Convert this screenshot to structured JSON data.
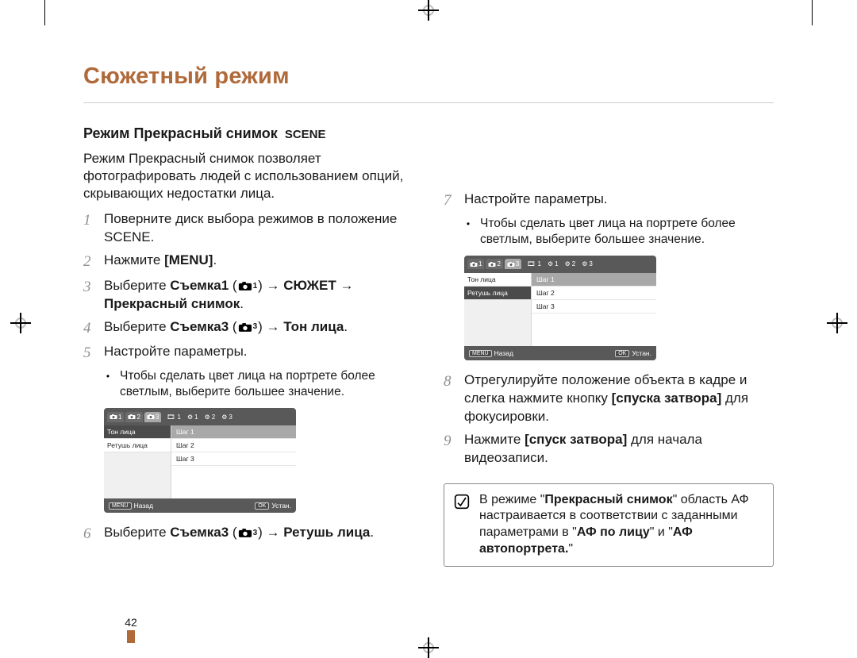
{
  "page": {
    "page_number": "42",
    "chapter_title": "Сюжетный режим",
    "section_title": "Режим Прекрасный снимок",
    "scene_word": "SCENE",
    "intro": "Режим Прекрасный снимок позволяет фотографировать людей с использованием опций, скрывающих недостатки лица."
  },
  "col_left": {
    "steps": {
      "s1_a": "Поверните диск выбора режимов в положение ",
      "s1_b": ".",
      "s2_a": "Нажмите ",
      "s2_menu": "[MENU]",
      "s2_b": ".",
      "s3_a": "Выберите ",
      "s3_bold1": "Съемка1",
      "s3_mid1": " (",
      "s3_mid2": ") → ",
      "s3_bold2": "СЮЖЕТ",
      "s3_mid3": " → ",
      "s3_bold3": "Прекрасный снимок",
      "s3_end": ".",
      "s4_a": "Выберите ",
      "s4_bold1": "Съемка3",
      "s4_mid1": " (",
      "s4_mid2": ") → ",
      "s4_bold2": "Тон лица",
      "s4_end": ".",
      "s5": "Настройте параметры.",
      "s5_sub": "Чтобы сделать цвет лица на портрете более светлым, выберите большее значение.",
      "s6_a": "Выберите ",
      "s6_bold1": "Съемка3",
      "s6_mid1": " (",
      "s6_mid2": ") → ",
      "s6_bold2": "Ретушь лица",
      "s6_end": "."
    }
  },
  "col_right": {
    "steps": {
      "s7": "Настройте параметры.",
      "s7_sub": "Чтобы сделать цвет лица на портрете более светлым, выберите большее значение.",
      "s8_a": "Отрегулируйте положение объекта в кадре и слегка нажмите кнопку ",
      "s8_bold": "[спуска затвора]",
      "s8_b": " для фокусировки.",
      "s9_a": "Нажмите ",
      "s9_bold": "[спуск затвора]",
      "s9_b": " для начала видеозаписи."
    },
    "note_a": "В режиме \"",
    "note_bold1": "Прекрасный снимок",
    "note_b": "\" область АФ настраивается в соответствии с заданными параметрами в \"",
    "note_bold2": "АФ по лицу",
    "note_c": "\" и \"",
    "note_bold3": "АФ автопортрета.",
    "note_d": "\""
  },
  "screenshot_a": {
    "left_rows": [
      "Тон лица",
      "Ретушь лица"
    ],
    "left_selected": 0,
    "right_rows": [
      "Шаг 1",
      "Шаг 2",
      "Шаг 3"
    ],
    "right_hl": 0,
    "footer": {
      "left_btn": "MENU",
      "left_txt": "Назад",
      "right_btn": "OK",
      "right_txt": "Устан."
    }
  },
  "screenshot_b": {
    "left_rows": [
      "Тон лица",
      "Ретушь лица"
    ],
    "left_selected": 1,
    "right_rows": [
      "Шаг 1",
      "Шаг 2",
      "Шаг 3"
    ],
    "right_hl": 0,
    "footer": {
      "left_btn": "MENU",
      "left_txt": "Назад",
      "right_btn": "OK",
      "right_txt": "Устан."
    }
  }
}
